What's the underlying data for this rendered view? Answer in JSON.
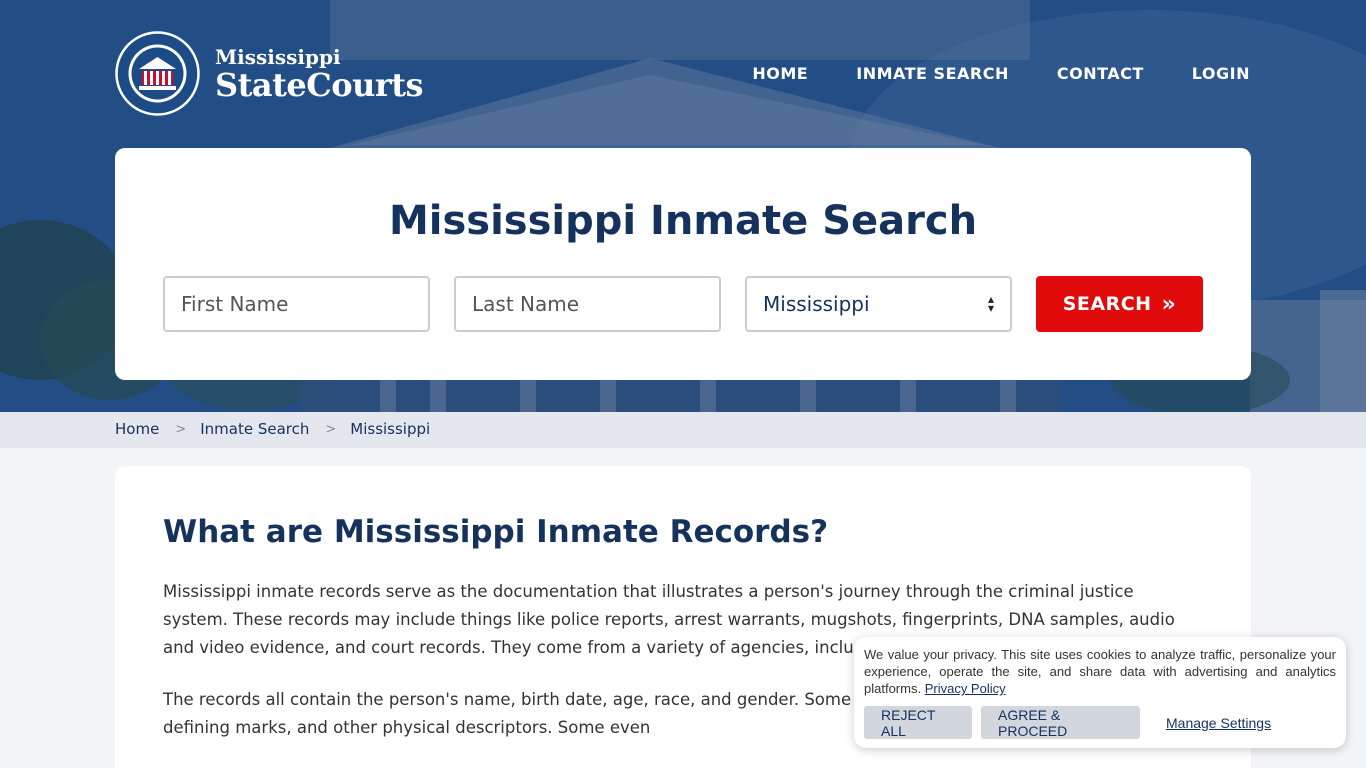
{
  "brand": {
    "line1": "Mississippi",
    "line2": "StateCourts",
    "seal_text": "MISSISSIPPI STATE COURTS"
  },
  "nav": {
    "items": [
      "HOME",
      "INMATE SEARCH",
      "CONTACT",
      "LOGIN"
    ]
  },
  "search": {
    "title": "Mississippi Inmate Search",
    "first_name_placeholder": "First Name",
    "last_name_placeholder": "Last Name",
    "state_selected": "Mississippi",
    "button_label": "SEARCH",
    "button_icon": "chevron-double-right-icon"
  },
  "breadcrumb": [
    "Home",
    "Inmate Search",
    "Mississippi"
  ],
  "content": {
    "heading": "What are Mississippi Inmate Records?",
    "p1": "Mississippi inmate records serve as the documentation that illustrates a person's journey through the criminal justice system. These records may include things like police reports, arrest warrants, mugshots, fingerprints, DNA samples, audio and video evidence, and court records. They come from a variety of agencies, including law enforcement, courts,",
    "p2": "The records all contain the person's name, birth date, age, race, and gender. Some may a and eye color, scars, tattoos, defining marks, and other physical descriptors. Some even"
  },
  "cookie": {
    "text": "We value your privacy. This site uses cookies to analyze traffic, personalize your experience, operate the site, and share data with advertising and analytics platforms.",
    "link": "Privacy Policy",
    "reject": "REJECT ALL",
    "agree": "AGREE & PROCEED",
    "manage": "Manage Settings"
  },
  "colors": {
    "navy": "#14325c",
    "accent_red": "#e10b0b",
    "hero_blue": "#2a5890"
  }
}
